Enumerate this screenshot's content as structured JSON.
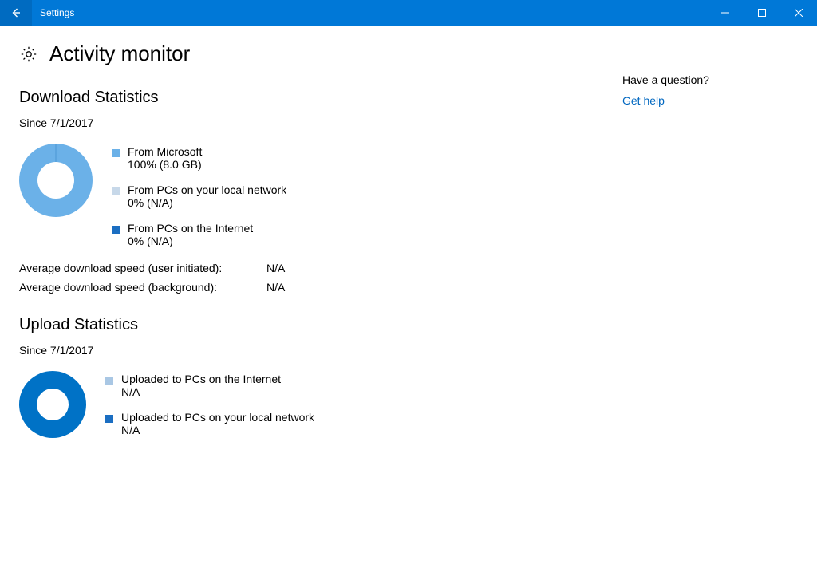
{
  "window": {
    "title": "Settings"
  },
  "page": {
    "title": "Activity monitor"
  },
  "download": {
    "heading": "Download Statistics",
    "since": "Since 7/1/2017",
    "legend": [
      {
        "label": "From Microsoft",
        "value": "100% (8.0 GB)",
        "color": "#6bb1e8"
      },
      {
        "label": "From PCs on your local network",
        "value": "0% (N/A)",
        "color": "#c7d8e9"
      },
      {
        "label": "From PCs on the Internet",
        "value": "0% (N/A)",
        "color": "#1b6ec2"
      }
    ],
    "speed": [
      {
        "label": "Average download speed (user initiated):",
        "value": "N/A"
      },
      {
        "label": "Average download speed (background):",
        "value": "N/A"
      }
    ]
  },
  "upload": {
    "heading": "Upload Statistics",
    "since": "Since 7/1/2017",
    "legend": [
      {
        "label": "Uploaded to PCs on the Internet",
        "value": "N/A",
        "color": "#6bb1e8"
      },
      {
        "label": "Uploaded to PCs on your local network",
        "value": "N/A",
        "color": "#1b6ec2"
      }
    ]
  },
  "help": {
    "question": "Have a question?",
    "link": "Get help"
  },
  "colors": {
    "accent": "#0078d7",
    "donut_download": "#6bb1e8",
    "donut_upload": "#0072c6"
  },
  "chart_data": [
    {
      "type": "pie",
      "title": "Download Statistics",
      "series": [
        {
          "name": "From Microsoft",
          "value": 100,
          "size": "8.0 GB"
        },
        {
          "name": "From PCs on your local network",
          "value": 0,
          "size": "N/A"
        },
        {
          "name": "From PCs on the Internet",
          "value": 0,
          "size": "N/A"
        }
      ]
    },
    {
      "type": "pie",
      "title": "Upload Statistics",
      "series": [
        {
          "name": "Uploaded to PCs on the Internet",
          "value": null
        },
        {
          "name": "Uploaded to PCs on your local network",
          "value": null
        }
      ]
    }
  ]
}
